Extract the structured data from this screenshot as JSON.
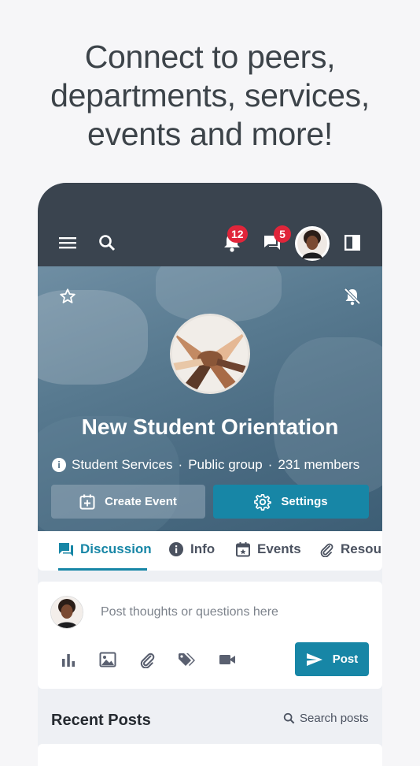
{
  "headline": {
    "line1": "Connect to peers,",
    "line2": "departments, services,",
    "line3": "events and more!"
  },
  "topbar": {
    "notifications_count": "12",
    "messages_count": "5",
    "colors": {
      "bar": "#3a444f",
      "badge": "#e0253a"
    }
  },
  "group": {
    "name": "New Student Orientation",
    "department": "Student Services",
    "separator": "·",
    "visibility": "Public group",
    "members": "231 members"
  },
  "actions": {
    "create_event": "Create Event",
    "settings": "Settings"
  },
  "tabs": [
    {
      "label": "Discussion",
      "icon": "forum-icon",
      "active": true
    },
    {
      "label": "Info",
      "icon": "info-icon",
      "active": false
    },
    {
      "label": "Events",
      "icon": "calendar-icon",
      "active": false
    },
    {
      "label": "Resour",
      "icon": "paperclip-icon",
      "active": false
    }
  ],
  "composer": {
    "placeholder": "Post thoughts or questions here",
    "post_label": "Post",
    "tools": [
      "poll-icon",
      "image-icon",
      "attach-icon",
      "tag-icon",
      "video-icon"
    ]
  },
  "recent": {
    "title": "Recent Posts",
    "search_label": "Search posts"
  },
  "accent": "#1786a6"
}
